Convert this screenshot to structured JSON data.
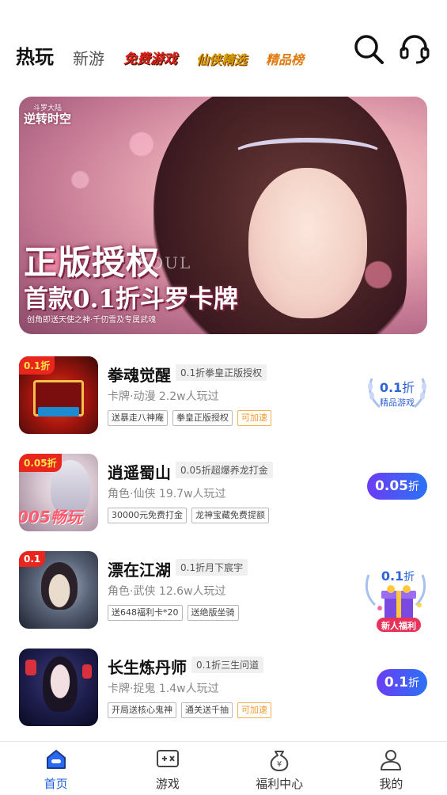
{
  "header": {
    "tabs": [
      {
        "label": "热玩"
      },
      {
        "label": "新游"
      },
      {
        "label": "免费游戏"
      },
      {
        "label": "仙侠精选"
      },
      {
        "label": "精品榜"
      }
    ]
  },
  "banner": {
    "logo_top": "斗罗大陆",
    "logo": "逆转时空",
    "title": "正版授权",
    "subtitle": "首款0.1折斗罗卡牌",
    "note": "创角即送天使之神·千仞雪及专属武魂",
    "watermark": "SOUL"
  },
  "games": [
    {
      "name": "拳魂觉醒",
      "subtitle": "0.1折拳皇正版授权",
      "category": "卡牌·动漫",
      "players": "2.2w人玩过",
      "tags": [
        "送暴走八神庵",
        "拳皇正版授权",
        "可加速"
      ],
      "ribbon": "0.1折",
      "discount": "0.1",
      "discount_unit": "折",
      "badge_label": "精品游戏"
    },
    {
      "name": "逍遥蜀山",
      "subtitle": "0.05折超爆养龙打金",
      "category": "角色·仙侠",
      "players": "19.7w人玩过",
      "tags": [
        "30000元免费打金",
        "龙神宝藏免费提额"
      ],
      "ribbon": "0.05折",
      "icon_text": "005畅玩",
      "discount": "0.05",
      "discount_unit": "折"
    },
    {
      "name": "漂在江湖",
      "subtitle": "0.1折月下宸宇",
      "category": "角色·武侠",
      "players": "12.6w人玩过",
      "tags": [
        "送648福利卡*20",
        "送绝版坐骑"
      ],
      "ribbon": "0.1",
      "discount": "0.1",
      "discount_unit": "折",
      "badge_label": "新人福利"
    },
    {
      "name": "长生炼丹师",
      "subtitle": "0.1折三生问道",
      "category": "卡牌·捉鬼",
      "players": "1.4w人玩过",
      "tags": [
        "开局送核心鬼神",
        "通关送千抽",
        "可加速"
      ],
      "discount": "0.1",
      "discount_unit": "折"
    }
  ],
  "nav": [
    {
      "label": "首页"
    },
    {
      "label": "游戏"
    },
    {
      "label": "福利中心"
    },
    {
      "label": "我的"
    }
  ],
  "colors": {
    "accent": "#1f5fe0",
    "pill_start": "#6b3df5",
    "pill_end": "#2b72f5",
    "tag_orange": "#f29a2e"
  }
}
